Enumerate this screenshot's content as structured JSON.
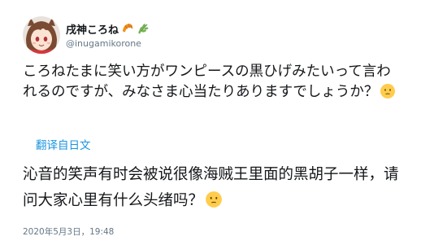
{
  "user": {
    "display_name": "戌神ころね",
    "handle": "@inugamikorone",
    "name_emojis": [
      "croissant-icon",
      "herb-icon"
    ]
  },
  "tweet": {
    "text": "ころねたまに笑い方がワンピースの黒ひげみたいって言われるのですが、みなさま心当たりありますでしょうか？",
    "emoji": "face-icon"
  },
  "translation": {
    "link_label": "翻译自日文",
    "text": "沁音的笑声有时会被说很像海贼王里面的黑胡子一样，请问大家心里有什么头绪吗？",
    "emoji": "face-icon"
  },
  "timestamp": "2020年5月3日，19:48",
  "colors": {
    "text": "#14171a",
    "secondary": "#657786",
    "link": "#1b95e0",
    "emoji_face": "#ffcc4d"
  }
}
